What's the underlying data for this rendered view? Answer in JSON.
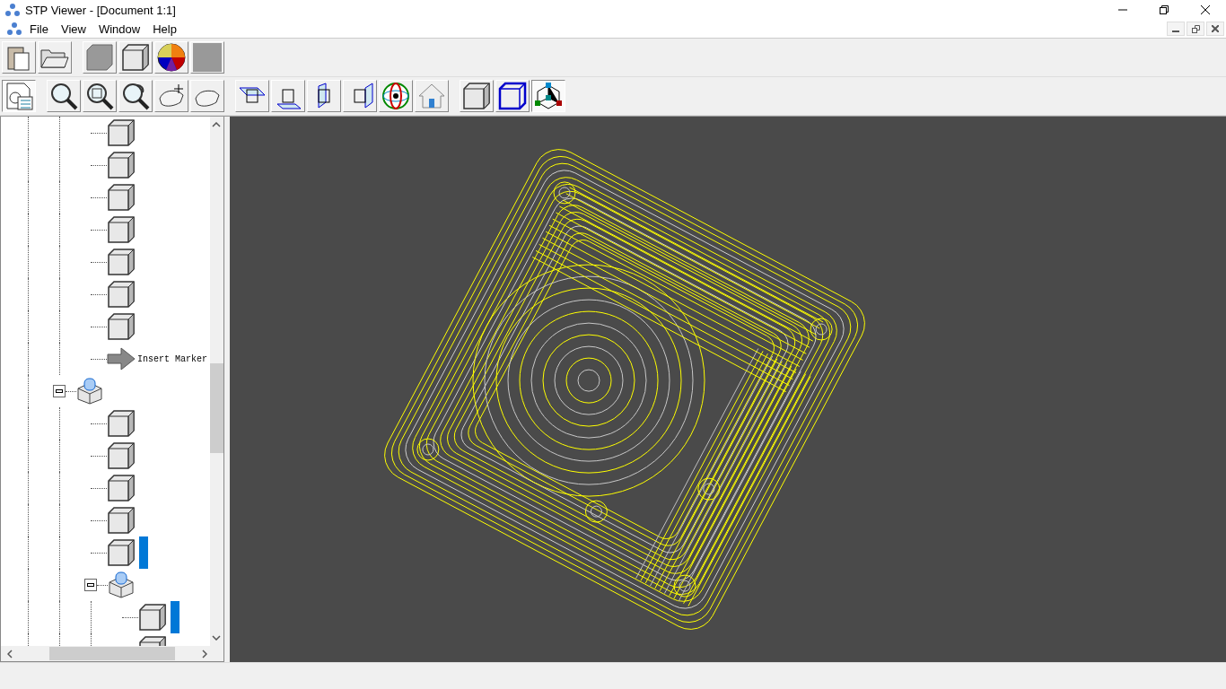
{
  "window": {
    "title": "STP Viewer - [Document 1:1]"
  },
  "menu": [
    "File",
    "View",
    "Window",
    "Help"
  ],
  "tree": [
    {
      "children": [
        {
          "kind": "part",
          "selected": false
        },
        {
          "kind": "part",
          "selected": false
        },
        {
          "kind": "part",
          "selected": false
        },
        {
          "kind": "part",
          "selected": false
        },
        {
          "kind": "part",
          "selected": false
        },
        {
          "kind": "part",
          "selected": false
        },
        {
          "kind": "part",
          "selected": false
        },
        {
          "kind": "marker",
          "label": "Insert Marker",
          "selected": false
        }
      ]
    },
    {
      "kind": "assembly",
      "expanded": true,
      "selected": false,
      "children": [
        {
          "kind": "part",
          "selected": false
        },
        {
          "kind": "part",
          "selected": false
        },
        {
          "kind": "part",
          "selected": false
        },
        {
          "kind": "part",
          "selected": false
        },
        {
          "kind": "part",
          "selected": true
        },
        {
          "kind": "assembly",
          "expanded": true,
          "selected": false,
          "children": [
            {
              "kind": "part",
              "selected": true
            },
            {
              "kind": "part",
              "selected": false
            }
          ]
        }
      ]
    }
  ]
}
